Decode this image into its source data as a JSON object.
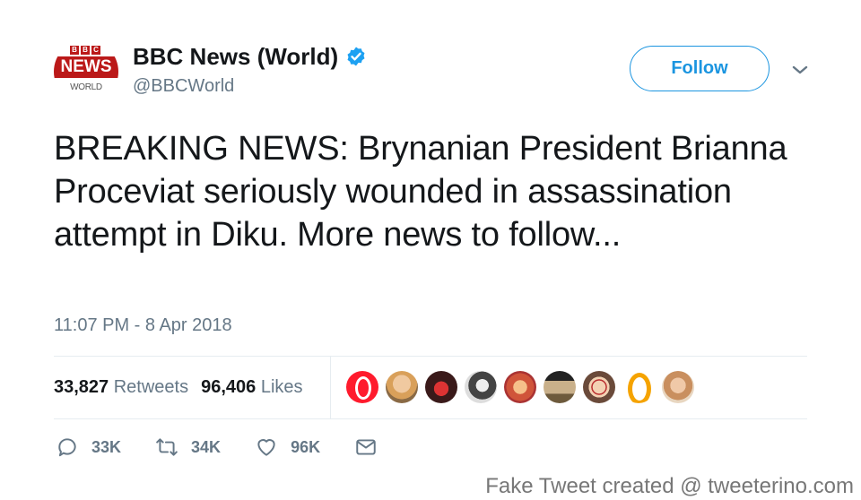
{
  "account": {
    "logo_blocks": [
      "B",
      "B",
      "C"
    ],
    "logo_band": "NEWS",
    "logo_sub": "WORLD",
    "name": "BBC News (World)",
    "handle": "@BBCWorld"
  },
  "follow": {
    "label": "Follow"
  },
  "tweet": {
    "text": "BREAKING NEWS: Brynanian President Brianna Proceviat seriously wounded in assassination attempt in Diku. More news to follow...",
    "timestamp": "11:07 PM - 8 Apr 2018"
  },
  "stats": {
    "retweets_count": "33,827",
    "retweets_label": "Retweets",
    "likes_count": "96,406",
    "likes_label": "Likes"
  },
  "likers": [
    "opera-logo-red",
    "person",
    "red-arrow-logo",
    "person-bw",
    "person",
    "person",
    "person-glasses",
    "opera-logo-yellow",
    "person"
  ],
  "actions": {
    "reply_count": "33K",
    "retweet_count": "34K",
    "like_count": "96K"
  },
  "watermark": "Fake Tweet created @ tweeterino.com",
  "colors": {
    "brand_red": "#bb1919",
    "accent_blue": "#1b95e0",
    "muted": "#657786"
  }
}
